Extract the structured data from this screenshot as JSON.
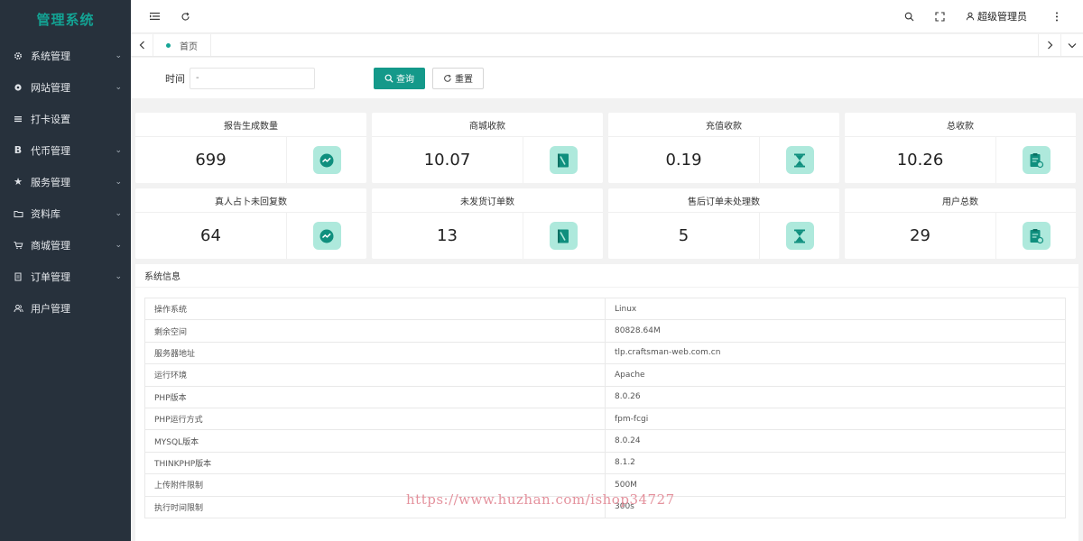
{
  "app": {
    "title": "管理系统"
  },
  "sidebar": {
    "items": [
      {
        "label": "系统管理",
        "icon": "gear-icon",
        "has_children": true
      },
      {
        "label": "网站管理",
        "icon": "cog-icon",
        "has_children": true
      },
      {
        "label": "打卡设置",
        "icon": "list-icon",
        "has_children": false
      },
      {
        "label": "代币管理",
        "icon": "bold-b-icon",
        "has_children": true
      },
      {
        "label": "服务管理",
        "icon": "star-icon",
        "has_children": true
      },
      {
        "label": "资料库",
        "icon": "folder-icon",
        "has_children": true
      },
      {
        "label": "商城管理",
        "icon": "cart-icon",
        "has_children": true
      },
      {
        "label": "订单管理",
        "icon": "document-icon",
        "has_children": true
      },
      {
        "label": "用户管理",
        "icon": "users-icon",
        "has_children": false
      }
    ]
  },
  "header": {
    "user_name": "超级管理员"
  },
  "tabs": {
    "home": "首页"
  },
  "filter": {
    "time_label": "时间",
    "time_placeholder": "-",
    "query_label": "查询",
    "reset_label": "重置"
  },
  "stats": [
    {
      "title": "报告生成数量",
      "value": "699",
      "icon": "trend-check-icon"
    },
    {
      "title": "商城收款",
      "value": "10.07",
      "icon": "book-icon"
    },
    {
      "title": "充值收款",
      "value": "0.19",
      "icon": "hourglass-icon"
    },
    {
      "title": "总收款",
      "value": "10.26",
      "icon": "clipboard-icon"
    },
    {
      "title": "真人占卜未回复数",
      "value": "64",
      "icon": "trend-check-icon"
    },
    {
      "title": "未发货订单数",
      "value": "13",
      "icon": "book-icon"
    },
    {
      "title": "售后订单未处理数",
      "value": "5",
      "icon": "hourglass-icon"
    },
    {
      "title": "用户总数",
      "value": "29",
      "icon": "clipboard-icon"
    }
  ],
  "system_info": {
    "title": "系统信息",
    "rows": [
      {
        "key": "操作系统",
        "value": "Linux"
      },
      {
        "key": "剩余空间",
        "value": "80828.64M"
      },
      {
        "key": "服务器地址",
        "value": "tlp.craftsman-web.com.cn"
      },
      {
        "key": "运行环境",
        "value": "Apache"
      },
      {
        "key": "PHP版本",
        "value": "8.0.26"
      },
      {
        "key": "PHP运行方式",
        "value": "fpm-fcgi"
      },
      {
        "key": "MYSQL版本",
        "value": "8.0.24"
      },
      {
        "key": "THINKPHP版本",
        "value": "8.1.2"
      },
      {
        "key": "上传附件限制",
        "value": "500M"
      },
      {
        "key": "执行时间限制",
        "value": "300s"
      }
    ]
  },
  "watermark": "https://www.huzhan.com/ishop34727",
  "colors": {
    "accent": "#14998a",
    "sidebar_bg": "#27313c",
    "logo": "#13a394",
    "icon_bg": "#aee9dc",
    "icon_fg": "#0f8f7e"
  }
}
